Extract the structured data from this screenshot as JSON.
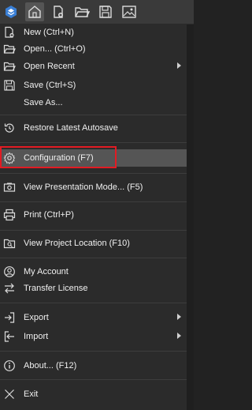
{
  "toolbar": {
    "buttons": [
      {
        "icon": "app-logo-icon"
      },
      {
        "icon": "home-icon"
      },
      {
        "icon": "new-file-icon"
      },
      {
        "icon": "open-folder-icon"
      },
      {
        "icon": "save-icon"
      },
      {
        "icon": "image-icon"
      }
    ]
  },
  "menu": {
    "new": "New (Ctrl+N)",
    "open": "Open... (Ctrl+O)",
    "open_recent": "Open Recent",
    "save": "Save (Ctrl+S)",
    "save_as": "Save As...",
    "restore": "Restore Latest Autosave",
    "configuration": "Configuration (F7)",
    "presentation": "View Presentation Mode... (F5)",
    "print": "Print (Ctrl+P)",
    "project_location": "View Project Location (F10)",
    "account": "My Account",
    "transfer": "Transfer License",
    "export": "Export",
    "import": "Import",
    "about": "About... (F12)",
    "exit": "Exit"
  },
  "colors": {
    "highlight_border": "#e21b23",
    "accent": "#3a7fd5"
  }
}
